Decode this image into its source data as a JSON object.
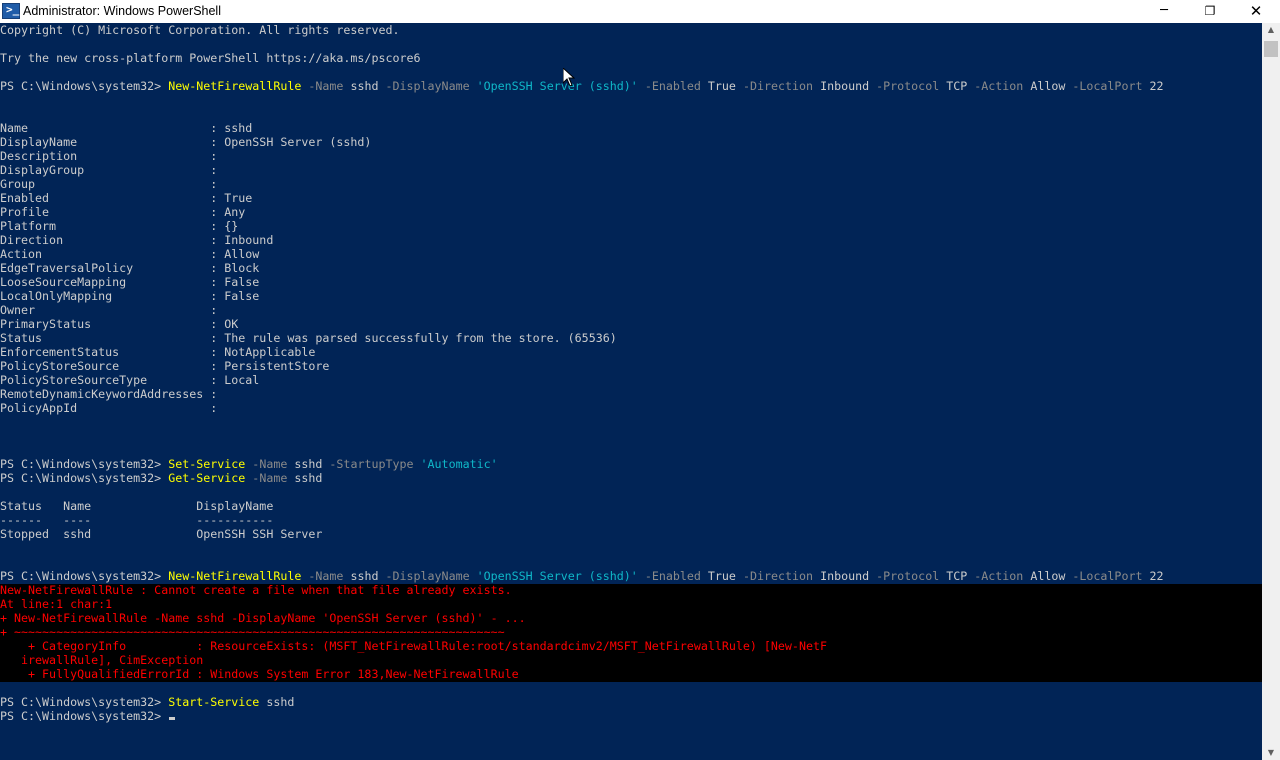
{
  "window": {
    "title": "Administrator: Windows PowerShell",
    "minimize_glyph": "─",
    "maximize_glyph": "❐",
    "close_glyph": "✕",
    "icon": "powershell-icon",
    "icon_glyph": ">_"
  },
  "colors": {
    "background": "#012456",
    "text": "#cccccc",
    "command": "#ffff00",
    "parameter": "#8a8a8a",
    "string": "#0fb8c9",
    "error": "#ff0000",
    "error_background": "#000000"
  },
  "console": {
    "copyright": "Copyright (C) Microsoft Corporation. All rights reserved.",
    "try_line": "Try the new cross-platform PowerShell https://aka.ms/pscore6",
    "prompt": "PS C:\\Windows\\system32> ",
    "cmd1": {
      "cmdlet": "New-NetFirewallRule",
      "p_name": " -Name ",
      "v_name": "sshd",
      "p_display": " -DisplayName ",
      "v_display": "'OpenSSH Server (sshd)'",
      "p_enabled": " -Enabled ",
      "v_enabled": "True",
      "p_direction": " -Direction ",
      "v_direction": "Inbound",
      "p_protocol": " -Protocol ",
      "v_protocol": "TCP",
      "p_action": " -Action ",
      "v_action": "Allow",
      "p_localport": " -LocalPort ",
      "v_localport": "22"
    },
    "rule_output": [
      "Name                          : sshd",
      "DisplayName                   : OpenSSH Server (sshd)",
      "Description                   :",
      "DisplayGroup                  :",
      "Group                         :",
      "Enabled                       : True",
      "Profile                       : Any",
      "Platform                      : {}",
      "Direction                     : Inbound",
      "Action                        : Allow",
      "EdgeTraversalPolicy           : Block",
      "LooseSourceMapping            : False",
      "LocalOnlyMapping              : False",
      "Owner                         :",
      "PrimaryStatus                 : OK",
      "Status                        : The rule was parsed successfully from the store. (65536)",
      "EnforcementStatus             : NotApplicable",
      "PolicyStoreSource             : PersistentStore",
      "PolicyStoreSourceType         : Local",
      "RemoteDynamicKeywordAddresses :",
      "PolicyAppId                   :"
    ],
    "cmd2": {
      "cmdlet": "Set-Service",
      "p_name": " -Name ",
      "v_name": "sshd",
      "p_startup": " -StartupType ",
      "v_startup": "'Automatic'"
    },
    "cmd3": {
      "cmdlet": "Get-Service",
      "p_name": " -Name ",
      "v_name": "sshd"
    },
    "service_table": [
      "Status   Name               DisplayName",
      "------   ----               -----------",
      "Stopped  sshd               OpenSSH SSH Server"
    ],
    "error_lines": [
      "New-NetFirewallRule : Cannot create a file when that file already exists.",
      "At line:1 char:1",
      "+ New-NetFirewallRule -Name sshd -DisplayName 'OpenSSH Server (sshd)' - ...",
      "+ ~~~~~~~~~~~~~~~~~~~~~~~~~~~~~~~~~~~~~~~~~~~~~~~~~~~~~~~~~~~~~~~~~~~~~~",
      "    + CategoryInfo          : ResourceExists: (MSFT_NetFirewallRule:root/standardcimv2/MSFT_NetFirewallRule) [New-NetF",
      "   irewallRule], CimException",
      "    + FullyQualifiedErrorId : Windows System Error 183,New-NetFirewallRule"
    ],
    "cmd5": {
      "cmdlet": "Start-Service",
      "arg": " sshd"
    }
  },
  "scrollbar": {
    "up_icon": "▲",
    "down_icon": "▼"
  }
}
